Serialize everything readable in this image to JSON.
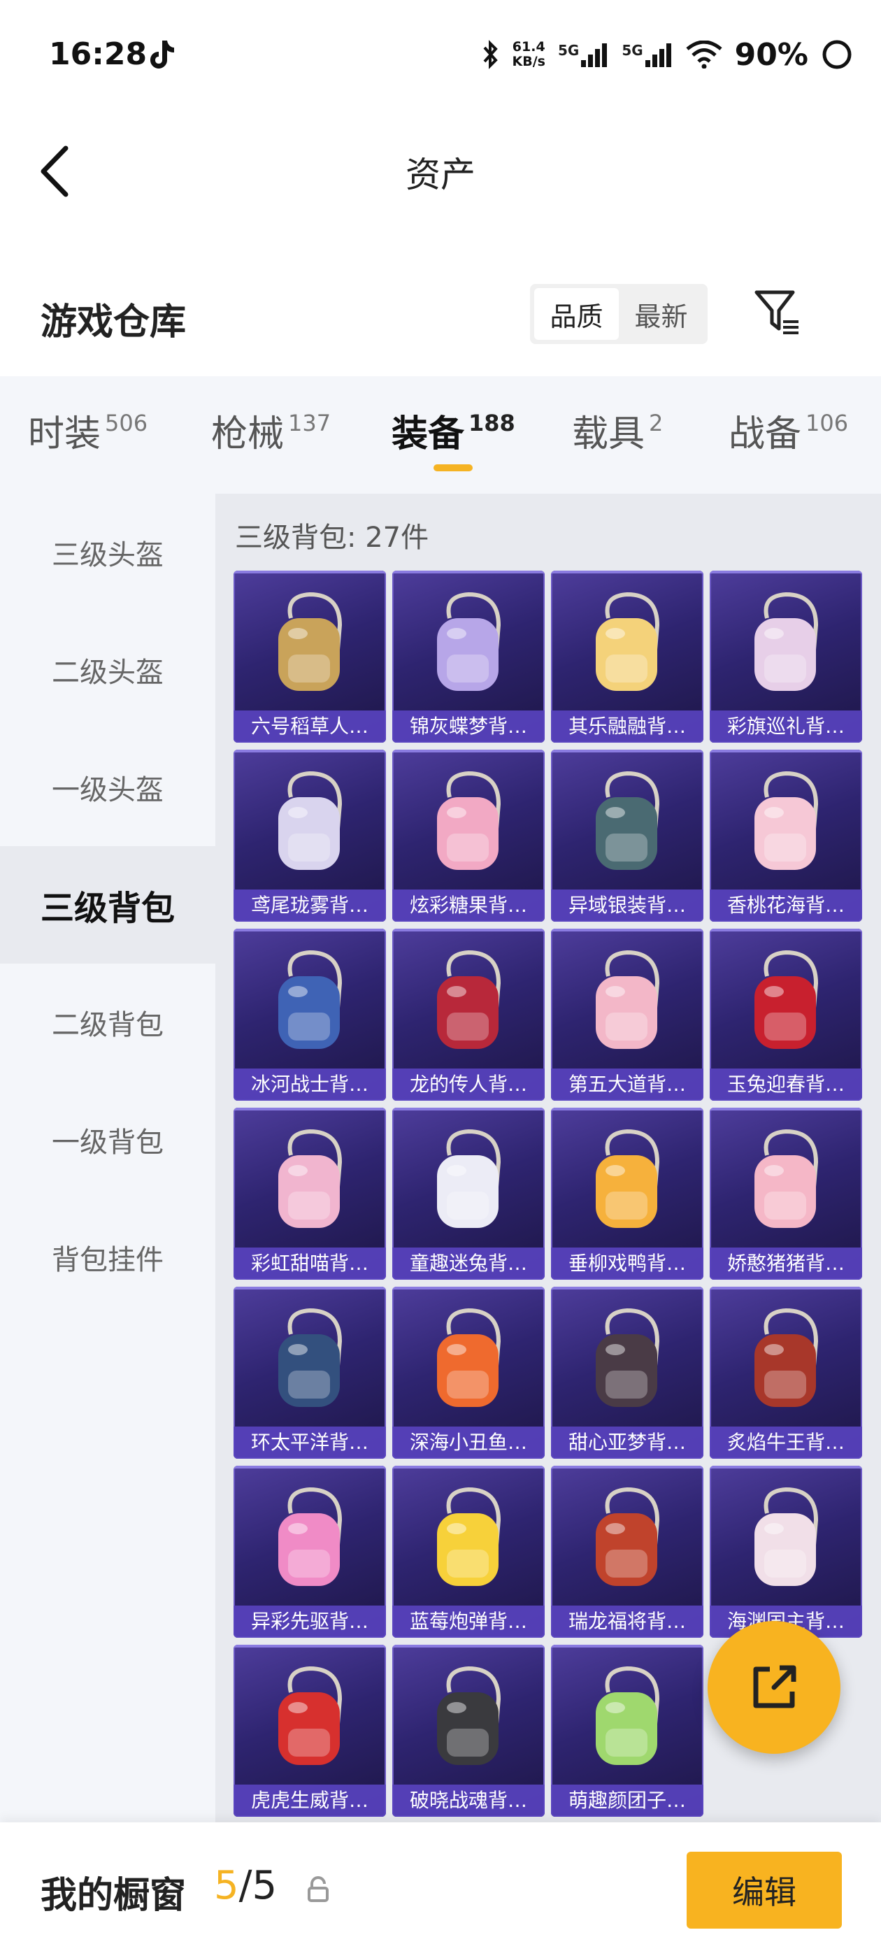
{
  "status_bar": {
    "time": "16:28",
    "net_speed_value": "61.4",
    "net_speed_unit": "KB/s",
    "signal_1": "5G",
    "signal_2": "5G",
    "battery": "90%"
  },
  "header": {
    "title": "资产"
  },
  "warehouse": {
    "title": "游戏仓库",
    "sort_options": [
      "品质",
      "最新"
    ],
    "sort_active": "品质"
  },
  "tabs": [
    {
      "label": "时装",
      "count": "506",
      "active": false
    },
    {
      "label": "枪械",
      "count": "137",
      "active": false
    },
    {
      "label": "装备",
      "count": "188",
      "active": true
    },
    {
      "label": "载具",
      "count": "2",
      "active": false
    },
    {
      "label": "战备",
      "count": "106",
      "active": false
    }
  ],
  "categories": [
    {
      "label": "三级头盔",
      "active": false
    },
    {
      "label": "二级头盔",
      "active": false
    },
    {
      "label": "一级头盔",
      "active": false
    },
    {
      "label": "三级背包",
      "active": true
    },
    {
      "label": "二级背包",
      "active": false
    },
    {
      "label": "一级背包",
      "active": false
    },
    {
      "label": "背包挂件",
      "active": false
    }
  ],
  "grid": {
    "count_label": "三级背包: 27件",
    "items": [
      {
        "name": "六号稻草人…",
        "icon": "scarecrow-backpack-icon",
        "color": "#c9a35a"
      },
      {
        "name": "锦灰蝶梦背…",
        "icon": "butterfly-backpack-icon",
        "color": "#b7a6e8"
      },
      {
        "name": "其乐融融背…",
        "icon": "bunny-backpack-icon",
        "color": "#f4d27a"
      },
      {
        "name": "彩旗巡礼背…",
        "icon": "flag-backpack-icon",
        "color": "#e7cfe8"
      },
      {
        "name": "鸢尾珑雾背…",
        "icon": "iris-backpack-icon",
        "color": "#d9d4ee"
      },
      {
        "name": "炫彩糖果背…",
        "icon": "donut-backpack-icon",
        "color": "#f2a9c4"
      },
      {
        "name": "异域银装背…",
        "icon": "silver-backpack-icon",
        "color": "#4a6a72"
      },
      {
        "name": "香桃花海背…",
        "icon": "peach-backpack-icon",
        "color": "#f6c8d6"
      },
      {
        "name": "冰河战士背…",
        "icon": "glacier-backpack-icon",
        "color": "#3f63b5"
      },
      {
        "name": "龙的传人背…",
        "icon": "dragon-heir-backpack-icon",
        "color": "#b8283a"
      },
      {
        "name": "第五大道背…",
        "icon": "fifth-avenue-backpack-icon",
        "color": "#f3b7c8"
      },
      {
        "name": "玉兔迎春背…",
        "icon": "jade-rabbit-backpack-icon",
        "color": "#c8202e"
      },
      {
        "name": "彩虹甜喵背…",
        "icon": "rainbow-cat-backpack-icon",
        "color": "#f1b5cf"
      },
      {
        "name": "童趣迷兔背…",
        "icon": "maze-bunny-backpack-icon",
        "color": "#ececf6"
      },
      {
        "name": "垂柳戏鸭背…",
        "icon": "duck-backpack-icon",
        "color": "#f6b13c"
      },
      {
        "name": "娇憨猪猪背…",
        "icon": "piggy-backpack-icon",
        "color": "#f5b7c7"
      },
      {
        "name": "环太平洋背…",
        "icon": "pacific-rim-backpack-icon",
        "color": "#33507e"
      },
      {
        "name": "深海小丑鱼…",
        "icon": "clownfish-backpack-icon",
        "color": "#ef6a2e"
      },
      {
        "name": "甜心亚梦背…",
        "icon": "sweetheart-backpack-icon",
        "color": "#4a3b46"
      },
      {
        "name": "炙焰牛王背…",
        "icon": "flame-bull-backpack-icon",
        "color": "#a8372a"
      },
      {
        "name": "异彩先驱背…",
        "icon": "pioneer-backpack-icon",
        "color": "#f08bc6"
      },
      {
        "name": "蓝莓炮弹背…",
        "icon": "blueberry-backpack-icon",
        "color": "#f7d13a"
      },
      {
        "name": "瑞龙福将背…",
        "icon": "lucky-dragon-backpack-icon",
        "color": "#c0432c"
      },
      {
        "name": "海渊国主背…",
        "icon": "abyss-lord-backpack-icon",
        "color": "#f1dfe8"
      },
      {
        "name": "虎虎生威背…",
        "icon": "tiger-backpack-icon",
        "color": "#d7302e"
      },
      {
        "name": "破晓战魂背…",
        "icon": "dawn-soul-backpack-icon",
        "color": "#3a3a3e"
      },
      {
        "name": "萌趣颜团子…",
        "icon": "dumpling-backpack-icon",
        "color": "#9fd86e"
      }
    ]
  },
  "showcase": {
    "label": "我的橱窗",
    "current": "5",
    "separator": "/",
    "total": "5",
    "edit_label": "编辑"
  },
  "colors": {
    "accent": "#f5b323",
    "card_bg": "#2e2470",
    "card_label_bg": "#5842be"
  }
}
